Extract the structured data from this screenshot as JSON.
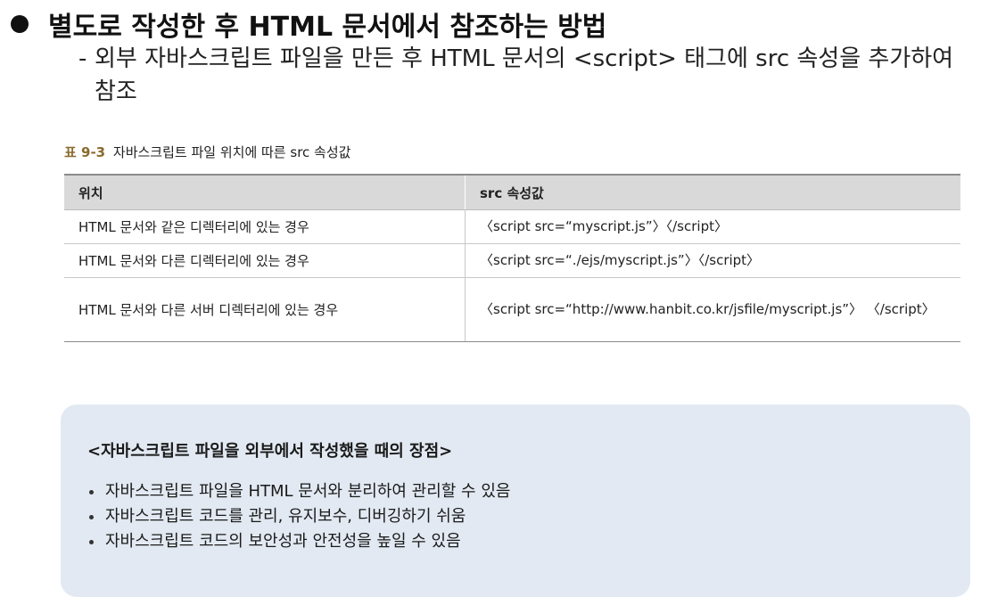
{
  "heading": "별도로 작성한 후 HTML 문서에서 참조하는 방법",
  "subpoint": {
    "dash": "-",
    "text": "외부 자바스크립트 파일을 만든 후 HTML 문서의 <script> 태그에 src 속성을 추가하여 참조"
  },
  "table": {
    "caption_number": "표 9-3",
    "caption_text": "자바스크립트 파일 위치에 따른 src 속성값",
    "headers": [
      "위치",
      "src 속성값"
    ],
    "rows": [
      [
        "HTML 문서와 같은 디렉터리에 있는 경우",
        "〈script src=“myscript.js”〉〈/script〉"
      ],
      [
        "HTML 문서와 다른 디렉터리에 있는 경우",
        "〈script src=“./ejs/myscript.js”〉〈/script〉"
      ],
      [
        "HTML 문서와 다른 서버 디렉터리에 있는 경우",
        "〈script src=“http://www.hanbit.co.kr/jsfile/myscript.js”〉 〈/script〉"
      ]
    ]
  },
  "callout": {
    "title": "<자바스크립트 파일을 외부에서 작성했을 때의 장점>",
    "items": [
      "자바스크립트 파일을 HTML 문서와 분리하여 관리할 수 있음",
      "자바스크립트 코드를 관리, 유지보수, 디버깅하기 쉬움",
      "자바스크립트 코드의 보안성과 안전성을 높일 수 있음"
    ]
  }
}
